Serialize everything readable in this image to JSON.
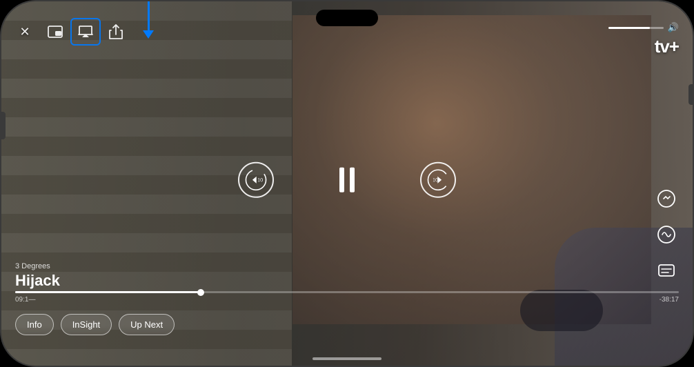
{
  "phone": {
    "frame_color": "#1a1a1a"
  },
  "header": {
    "close_label": "✕",
    "pip_label": "⊡",
    "airplay_label": "⬆",
    "share_label": "⬆",
    "volume_percent": 75,
    "appletv_brand": "tv+"
  },
  "show": {
    "subtitle": "3 Degrees",
    "title": "Hijack"
  },
  "playback": {
    "current_time": "09:1—",
    "remaining_time": "-38:17",
    "progress_percent": 28,
    "state": "playing"
  },
  "controls": {
    "skip_back_seconds": "10",
    "skip_forward_seconds": "10",
    "pause_label": "pause"
  },
  "bottom_tabs": [
    {
      "id": "info",
      "label": "Info"
    },
    {
      "id": "insight",
      "label": "InSight"
    },
    {
      "id": "up_next",
      "label": "Up Next"
    }
  ],
  "right_controls": [
    {
      "id": "speed",
      "icon": "⏱",
      "label": "Playback Speed"
    },
    {
      "id": "audio",
      "icon": "〰",
      "label": "Audio"
    },
    {
      "id": "subtitles",
      "icon": "💬",
      "label": "Subtitles"
    }
  ],
  "blue_arrow": {
    "color": "#007AFF",
    "points_to": "airplay"
  }
}
